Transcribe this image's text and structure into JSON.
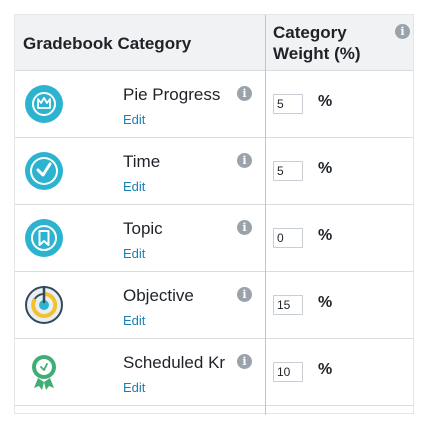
{
  "header": {
    "category_label": "Gradebook Category",
    "weight_label": "Category Weight (%)"
  },
  "rows": [
    {
      "name": "Pie Progress",
      "edit_label": "Edit",
      "weight": "5",
      "unit": "%",
      "icon": "crown-badge-icon",
      "icon_color": "#2bb3cf"
    },
    {
      "name": "Time",
      "edit_label": "Edit",
      "weight": "5",
      "unit": "%",
      "icon": "clock-icon",
      "icon_color": "#2bb3cf"
    },
    {
      "name": "Topic",
      "edit_label": "Edit",
      "weight": "0",
      "unit": "%",
      "icon": "bookmark-icon",
      "icon_color": "#2bb3cf"
    },
    {
      "name": "Objective",
      "edit_label": "Edit",
      "weight": "15",
      "unit": "%",
      "icon": "target-icon",
      "icon_color": "#2bb3cf"
    },
    {
      "name": "Scheduled Kr",
      "edit_label": "Edit",
      "weight": "10",
      "unit": "%",
      "icon": "ribbon-award-icon",
      "icon_color": "#3fae74"
    }
  ],
  "colors": {
    "accent": "#2bb3cf",
    "link": "#1a7fb5",
    "award": "#3fae74",
    "header_bg": "#f0f2f4"
  }
}
